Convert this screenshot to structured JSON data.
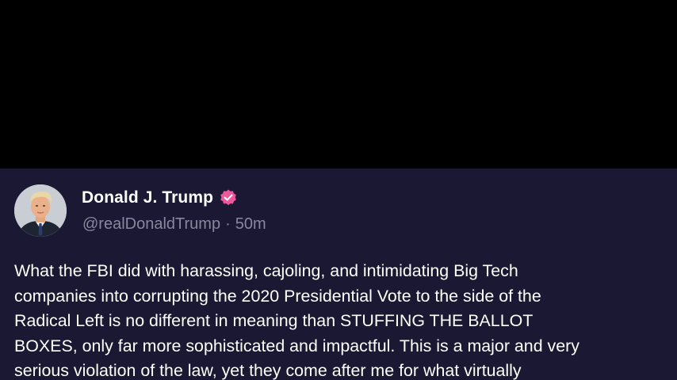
{
  "post": {
    "author": {
      "display_name": "Donald J. Trump",
      "handle": "@realDonaldTrump",
      "separator": "·",
      "time_ago": "50m",
      "verified_badge_color": "#f0569a",
      "avatar_icon": "profile-photo"
    },
    "body_lines": [
      "What the FBI did with harassing, cajoling, and intimidating Big Tech",
      "companies into corrupting the 2020 Presidential Vote to the side of the",
      "Radical Left is no different in meaning than STUFFING THE BALLOT",
      "BOXES, only far more sophisticated and impactful. This is a major and very",
      "serious violation of the law, yet they come after me for what virtually"
    ]
  },
  "colors": {
    "background_top": "#000000",
    "card_background": "#1b1834",
    "text_primary": "#ffffff",
    "text_secondary": "#8a869e"
  }
}
